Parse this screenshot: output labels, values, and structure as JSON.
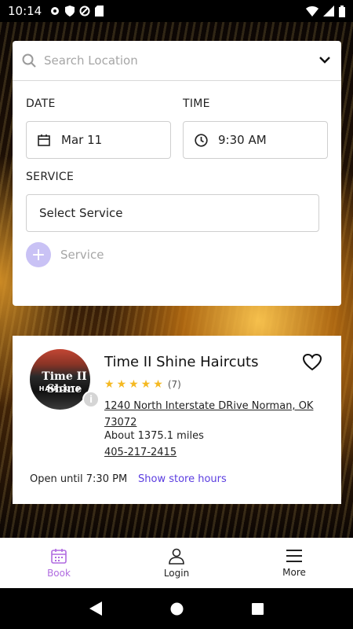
{
  "status_bar": {
    "time": "10:14"
  },
  "search": {
    "placeholder": "Search Location"
  },
  "booking": {
    "date_label": "DATE",
    "date_value": "Mar 11",
    "time_label": "TIME",
    "time_value": "9:30 AM",
    "service_label": "SERVICE",
    "service_select": "Select Service",
    "add_service_label": "Service"
  },
  "store": {
    "name": "Time II Shine Haircuts",
    "sign_text": "Time II Shine",
    "sign_subtext": "HAIRCUTS",
    "rating": 5,
    "review_count": "(7)",
    "address": "1240 North Interstate DRive Norman, OK 73072",
    "distance": "About 1375.1 miles",
    "phone": "405-217-2415",
    "open_status": "Open until 7:30 PM",
    "hours_link": "Show store hours"
  },
  "bottom_nav": [
    {
      "label": "Book",
      "icon": "calendar-icon",
      "active": true
    },
    {
      "label": "Login",
      "icon": "person-icon",
      "active": false
    },
    {
      "label": "More",
      "icon": "menu-icon",
      "active": false
    }
  ],
  "colors": {
    "accent": "#5b3de0",
    "active_nav": "#b06be0",
    "star": "#f5b922"
  }
}
